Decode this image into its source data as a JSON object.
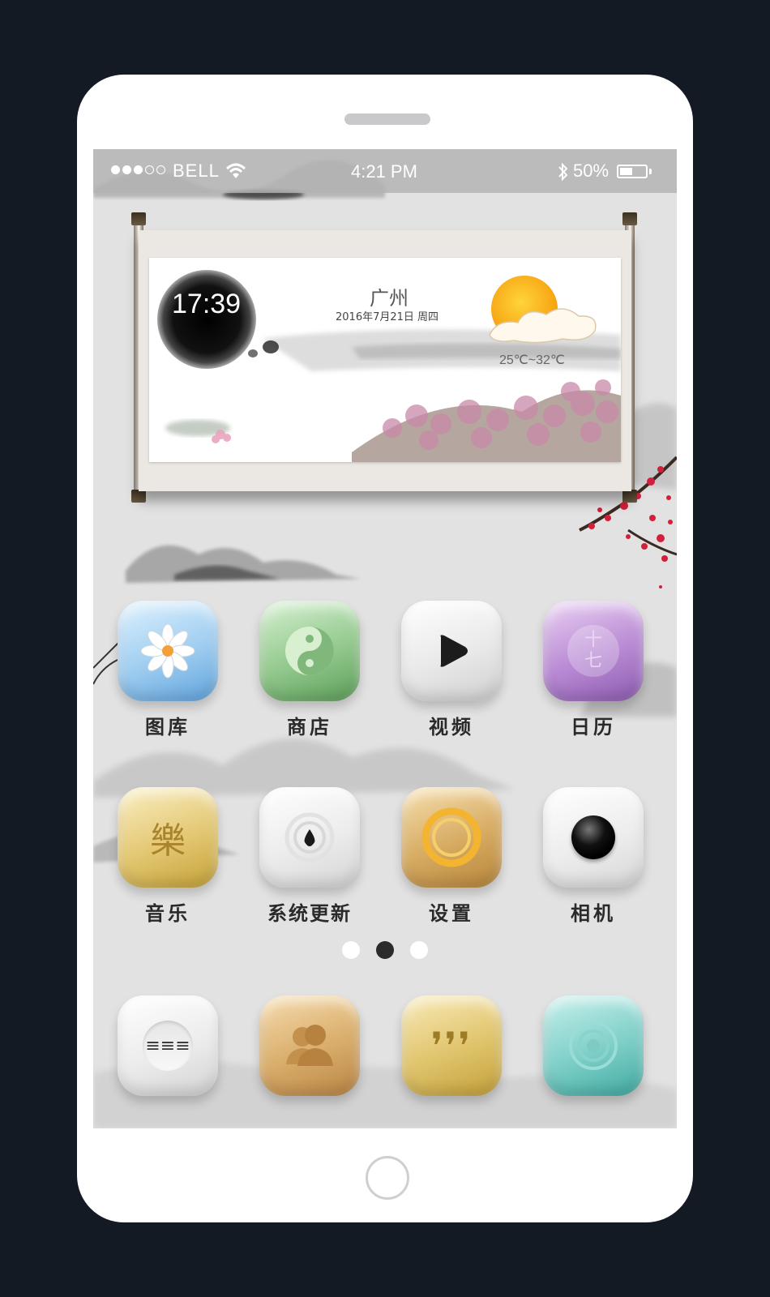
{
  "status_bar": {
    "signal_total": 5,
    "signal_filled": 3,
    "carrier": "BELL",
    "time": "4:21 PM",
    "battery": "50%",
    "battery_level": 0.5
  },
  "weather_widget": {
    "clock": "17:39",
    "city": "广州",
    "date": "2016年7月21日  周四",
    "temperature": "25℃~32℃"
  },
  "apps": [
    {
      "label": "图库",
      "icon": "flower-icon"
    },
    {
      "label": "商店",
      "icon": "yin-yang-icon"
    },
    {
      "label": "视频",
      "icon": "play-icon"
    },
    {
      "label": "日历",
      "icon": "calendar-icon"
    },
    {
      "label": "音乐",
      "icon": "music-icon"
    },
    {
      "label": "系统更新",
      "icon": "drop-icon"
    },
    {
      "label": "设置",
      "icon": "ring-icon"
    },
    {
      "label": "相机",
      "icon": "lens-icon"
    }
  ],
  "calendar_glyph": {
    "top": "十",
    "bottom": "七"
  },
  "music_glyph": "樂",
  "pager": {
    "count": 3,
    "active": 1
  },
  "dock": [
    {
      "icon": "dialpad-icon",
      "glyph": "≡≡≡"
    },
    {
      "icon": "contacts-icon"
    },
    {
      "icon": "messages-icon",
      "glyph": "❜❜❜"
    },
    {
      "icon": "browser-icon"
    }
  ]
}
